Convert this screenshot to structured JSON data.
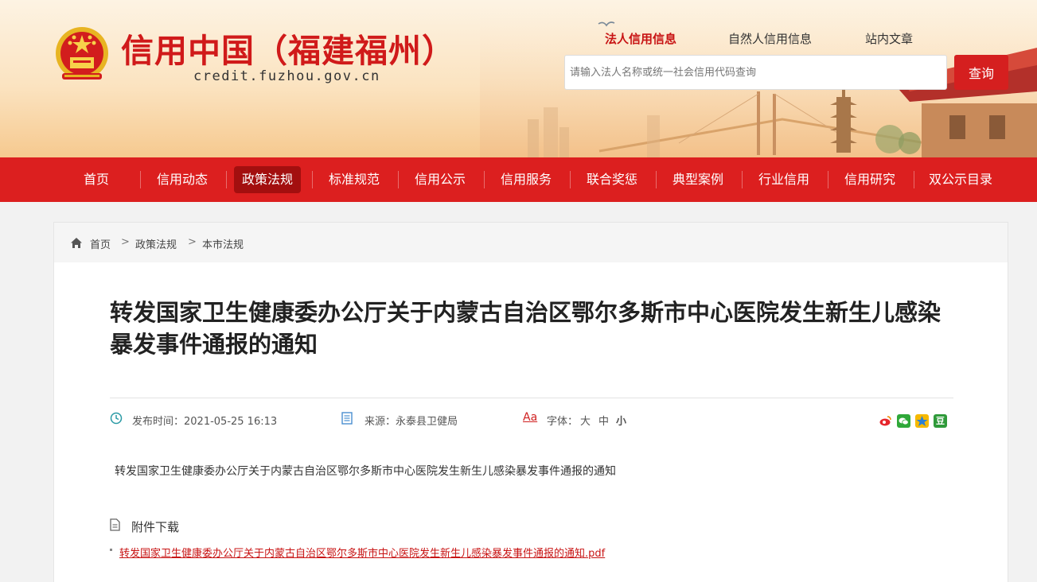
{
  "header": {
    "site_title": "信用中国（福建福州）",
    "site_domain": "credit.fuzhou.gov.cn",
    "tabs": [
      {
        "label": "法人信用信息",
        "active": true
      },
      {
        "label": "自然人信用信息",
        "active": false
      },
      {
        "label": "站内文章",
        "active": false
      }
    ],
    "search": {
      "placeholder": "请输入法人名称或统一社会信用代码查询",
      "button": "查询"
    },
    "accent_color": "#d51f1f"
  },
  "nav": {
    "items": [
      {
        "label": "首页",
        "active": false
      },
      {
        "label": "信用动态",
        "active": false
      },
      {
        "label": "政策法规",
        "active": true
      },
      {
        "label": "标准规范",
        "active": false
      },
      {
        "label": "信用公示",
        "active": false
      },
      {
        "label": "信用服务",
        "active": false
      },
      {
        "label": "联合奖惩",
        "active": false
      },
      {
        "label": "典型案例",
        "active": false
      },
      {
        "label": "行业信用",
        "active": false
      },
      {
        "label": "信用研究",
        "active": false
      },
      {
        "label": "双公示目录",
        "active": false
      }
    ]
  },
  "breadcrumb": {
    "items": [
      "首页",
      "政策法规",
      "本市法规"
    ],
    "separator": ">"
  },
  "article": {
    "title": "转发国家卫生健康委办公厅关于内蒙古自治区鄂尔多斯市中心医院发生新生儿感染暴发事件通报的通知",
    "publish_time": "发布时间：2021-05-25 16:13",
    "source": "来源：永泰县卫健局",
    "font_size_label": "字体：",
    "font_size_icon_label": "Aa",
    "font_sizes": [
      "大",
      "中",
      "小"
    ],
    "share_icons": [
      "weibo-icon",
      "wechat-icon",
      "qzone-icon",
      "douban-icon"
    ],
    "share_glyph_douban": "豆",
    "summary": "转发国家卫生健康委办公厅关于内蒙古自治区鄂尔多斯市中心医院发生新生儿感染暴发事件通报的通知",
    "attachments_heading": "附件下载",
    "attachments": [
      {
        "name": "转发国家卫生健康委办公厅关于内蒙古自治区鄂尔多斯市中心医院发生新生儿感染暴发事件通报的通知.pdf"
      }
    ]
  }
}
